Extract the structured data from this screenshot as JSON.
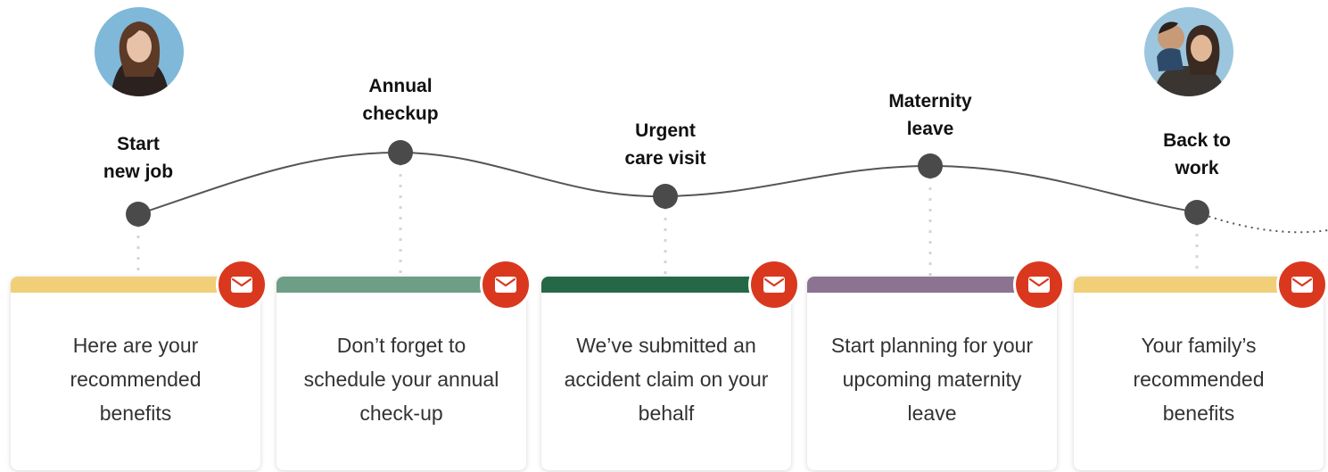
{
  "milestones": [
    {
      "label": "Start\nnew job",
      "message": "Here are your recommended benefits",
      "color": "#f0cf78"
    },
    {
      "label": "Annual\ncheckup",
      "message": "Don’t forget to schedule your annual check-up",
      "color": "#6e9e86"
    },
    {
      "label": "Urgent\ncare visit",
      "message": "We’ve submitted an accident claim on your behalf",
      "color": "#256848"
    },
    {
      "label": "Maternity\nleave",
      "message": "Start planning for your upcoming maternity leave",
      "color": "#8b7391"
    },
    {
      "label": "Back to\nwork",
      "message": "Your family’s recommended benefits",
      "color": "#f0cf78"
    }
  ],
  "icons": {
    "badge": "mail-icon",
    "badge_color": "#d9381e",
    "node_color": "#4a4a4a"
  },
  "avatars": [
    "woman-portrait-avatar",
    "mother-and-child-avatar"
  ]
}
